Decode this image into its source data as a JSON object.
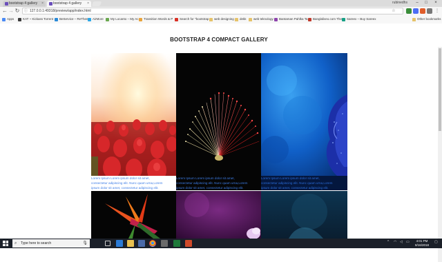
{
  "browser": {
    "tabs": [
      {
        "title": "bootstrap 4 gallery",
        "active": false
      },
      {
        "title": "bootstrap 4 gallery",
        "active": true
      }
    ],
    "profile_name": "rubinedhs",
    "url": "127.0.0.1:49318/preview/app/index.html",
    "bookmarks": [
      {
        "label": "Apps",
        "icon": "apps-icon"
      },
      {
        "label": "KAT ~ Kickass Torrent",
        "icon": "site-icon"
      },
      {
        "label": "BeService – ReTheme",
        "icon": "site-icon"
      },
      {
        "label": "AirMore",
        "icon": "site-icon"
      },
      {
        "label": "My Locanto – My Ac",
        "icon": "site-icon"
      },
      {
        "label": "Transition Words & P",
        "icon": "site-icon"
      },
      {
        "label": "Search for \"bootstrap",
        "icon": "site-icon"
      },
      {
        "label": "web designing",
        "icon": "folder-icon"
      },
      {
        "label": "dekk",
        "icon": "folder-icon"
      },
      {
        "label": "web teknology",
        "icon": "folder-icon"
      },
      {
        "label": "Bantaman Pahlka Ta",
        "icon": "site-icon"
      },
      {
        "label": "Banglaliveo.com The",
        "icon": "site-icon"
      },
      {
        "label": "Sareex – Buy Sareex",
        "icon": "site-icon"
      }
    ],
    "other_bookmarks": "Other bookmarks"
  },
  "page": {
    "title": "BOOTSTRAP 4 COMPACT GALLERY",
    "captions": [
      {
        "line1": "Lorem Ipsum Lorem ipsum dolor sit amet,",
        "line2": "consectetur adipiscing elit. Nunc quam urna,Lorem",
        "line3": "ipsum dolor sit amet, consectetur adipiscing elit."
      },
      {
        "line1": "Lorem Ipsum Lorem ipsum dolor sit amet,",
        "line2": "consectetur adipiscing elit. Nunc quam urna,Lorem",
        "line3": "ipsum dolor sit amet, consectetur adipiscing elit."
      },
      {
        "line1": "Lorem Ipsum Lorem ipsum dolor sit amet,",
        "line2": "consectetur adipiscing elit. Nunc quam urna,Lorem",
        "line3": "ipsum dolor sit amet, consectetur adipiscing elit."
      }
    ]
  },
  "taskbar": {
    "search_placeholder": "Type here to search",
    "time": "4:01 PM",
    "date": "8/16/2018"
  },
  "colors": {
    "caption_text": "#3d7de6",
    "taskbar_bg": "#1b2029"
  }
}
